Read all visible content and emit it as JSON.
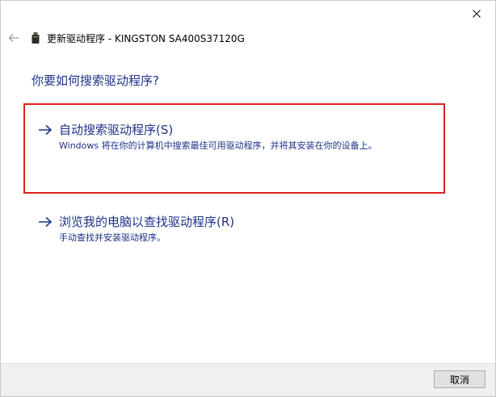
{
  "header": {
    "title": "更新驱动程序 - KINGSTON SA400S37120G",
    "device_icon": "usb-drive-icon",
    "back_icon": "back-arrow-icon",
    "close_icon": "close-icon"
  },
  "main": {
    "question": "你要如何搜索驱动程序?",
    "options": [
      {
        "title": "自动搜索驱动程序(S)",
        "description": "Windows 将在你的计算机中搜索最佳可用驱动程序，并将其安装在你的设备上。",
        "icon": "arrow-right-icon"
      },
      {
        "title": "浏览我的电脑以查找驱动程序(R)",
        "description": "手动查找并安装驱动程序。",
        "icon": "arrow-right-icon"
      }
    ]
  },
  "footer": {
    "cancel_label": "取消"
  },
  "colors": {
    "link": "#1e3287",
    "highlight": "#e02020",
    "footer_bg": "#f0f0f0"
  }
}
